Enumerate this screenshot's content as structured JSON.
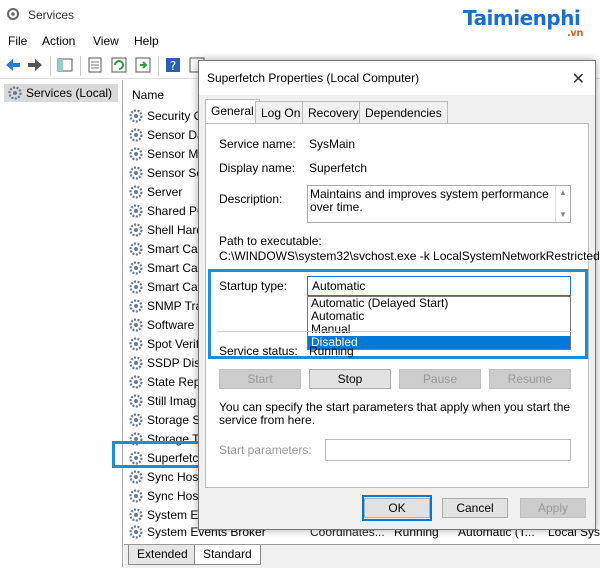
{
  "window": {
    "title": "Services"
  },
  "brand": {
    "logo": "Taimienphi",
    "logo_suffix": ".vn"
  },
  "menu": [
    "File",
    "Action",
    "View",
    "Help"
  ],
  "left_pane": {
    "item": "Services (Local)"
  },
  "list": {
    "header": "Name",
    "rows": [
      "Security C",
      "Sensor Da",
      "Sensor M",
      "Sensor Se",
      "Server",
      "Shared PC",
      "Shell Hard",
      "Smart Car",
      "Smart Car",
      "Smart Car",
      "SNMP Tra",
      "Software",
      "Spot Verif",
      "SSDP Disc",
      "State Rep",
      "Still Imag",
      "Storage S",
      "Storage T",
      "Superfetch",
      "Sync Hos",
      "Sync Hos",
      "System Ev"
    ],
    "last_row": {
      "name": "System Events Broker",
      "description": "Coordinates...",
      "status": "Running",
      "startup": "Automatic (T...",
      "logon": "Local Syst"
    }
  },
  "bottom_tabs": [
    "Extended",
    "Standard"
  ],
  "dialog": {
    "title": "Superfetch Properties (Local Computer)",
    "close": "✕",
    "tabs": [
      "General",
      "Log On",
      "Recovery",
      "Dependencies"
    ],
    "service_name_label": "Service name:",
    "service_name": "SysMain",
    "display_name_label": "Display name:",
    "display_name": "Superfetch",
    "description_label": "Description:",
    "description": "Maintains and improves system performance over time.",
    "path_label": "Path to executable:",
    "path": "C:\\WINDOWS\\system32\\svchost.exe -k LocalSystemNetworkRestricted",
    "startup_label": "Startup type:",
    "startup_value": "Automatic",
    "startup_options": [
      "Automatic (Delayed Start)",
      "Automatic",
      "Manual",
      "Disabled"
    ],
    "startup_highlighted": "Disabled",
    "status_label": "Service status:",
    "status_value": "Running",
    "buttons": {
      "start": "Start",
      "stop": "Stop",
      "pause": "Pause",
      "resume": "Resume"
    },
    "hint": "You can specify the start parameters that apply when you start the service from here.",
    "params_label": "Start parameters:",
    "footer": {
      "ok": "OK",
      "cancel": "Cancel",
      "apply": "Apply"
    }
  },
  "colors": {
    "highlight": "#1a8fd8",
    "selection": "#0078d7"
  }
}
